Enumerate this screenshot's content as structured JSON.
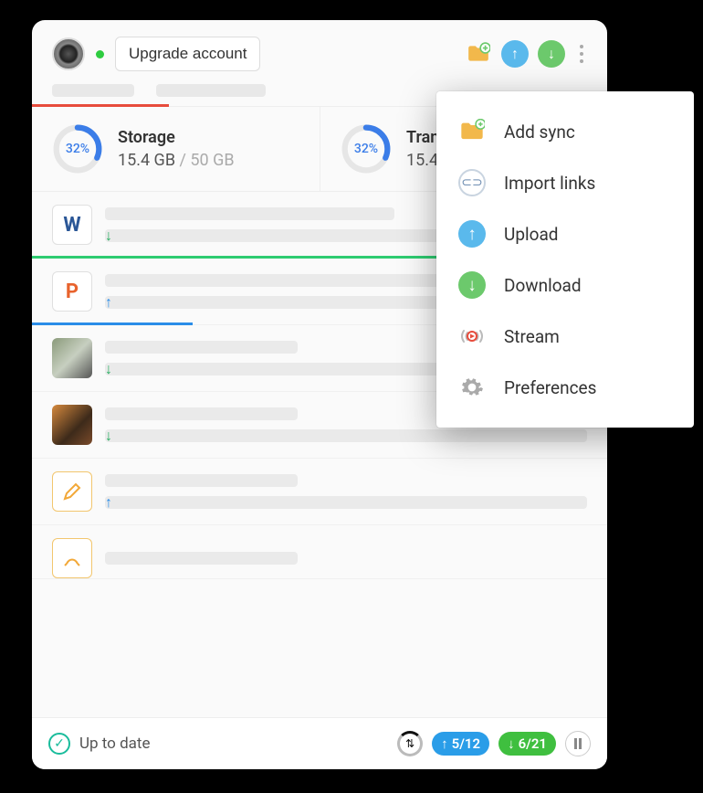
{
  "header": {
    "upgrade_label": "Upgrade account"
  },
  "stats": {
    "storage": {
      "title": "Storage",
      "percent_label": "32%",
      "percent": 32,
      "used": "15.4 GB",
      "total": "50 GB"
    },
    "transfer": {
      "title": "Transfer",
      "title_truncated": "Trans",
      "percent_label": "32%",
      "percent": 32,
      "used": "15.4"
    }
  },
  "files": [
    {
      "icon": "word",
      "letter": "W",
      "direction": "down",
      "direction_color": "green",
      "progress_pct": 100,
      "progress_color": "green"
    },
    {
      "icon": "ppt",
      "letter": "P",
      "direction": "up",
      "direction_color": "blue",
      "progress_pct": 28,
      "progress_color": "blue"
    },
    {
      "icon": "image",
      "direction": "down",
      "direction_color": "green"
    },
    {
      "icon": "image",
      "direction": "down",
      "direction_color": "green"
    },
    {
      "icon": "note",
      "direction": "up",
      "direction_color": "blue"
    },
    {
      "icon": "note"
    }
  ],
  "footer": {
    "status_label": "Up to date",
    "upload_counter": "5/12",
    "download_counter": "6/21"
  },
  "menu": {
    "add_sync": "Add sync",
    "import_links": "Import links",
    "upload": "Upload",
    "download": "Download",
    "stream": "Stream",
    "preferences": "Preferences"
  },
  "colors": {
    "accent_blue": "#2a8de8",
    "accent_green": "#2ecc71",
    "accent_red": "#e74c3c",
    "accent_orange": "#f2a838"
  }
}
